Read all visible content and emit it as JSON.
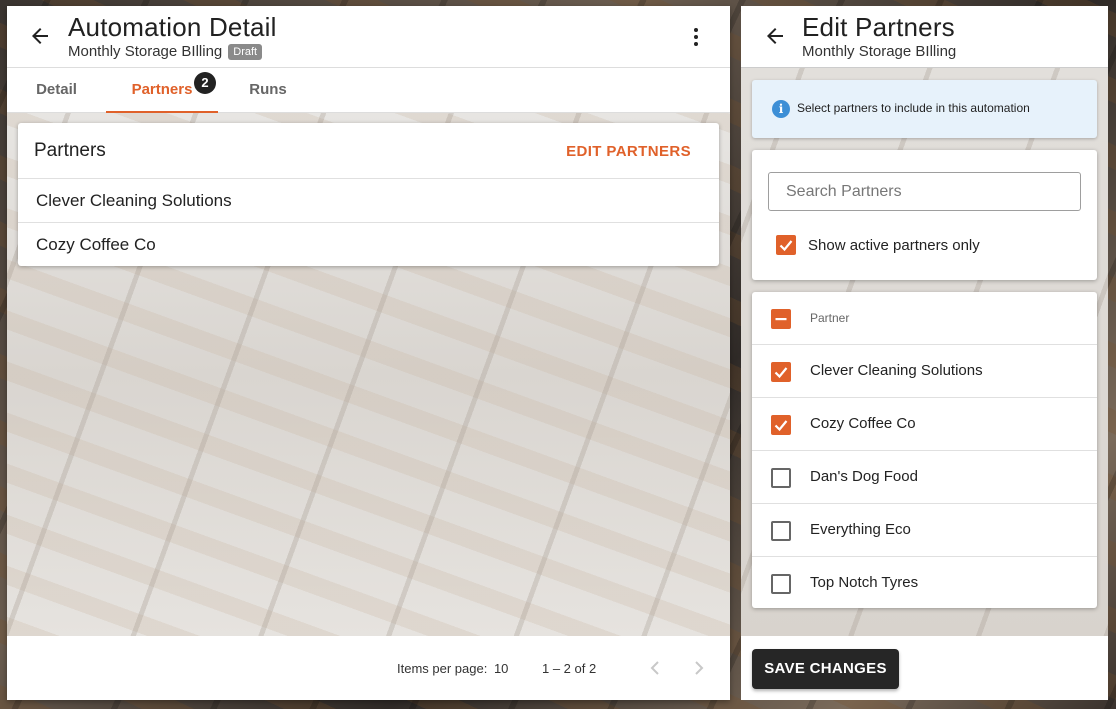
{
  "automation_detail": {
    "title": "Automation Detail",
    "subtitle": "Monthly Storage BIlling",
    "status_badge": "Draft",
    "tabs": [
      {
        "label": "Detail"
      },
      {
        "label": "Partners",
        "count": "2",
        "active": true
      },
      {
        "label": "Runs"
      }
    ],
    "partners_card": {
      "title": "Partners",
      "edit_label": "EDIT PARTNERS",
      "rows": [
        "Clever Cleaning Solutions",
        "Cozy Coffee Co"
      ]
    },
    "pagination": {
      "items_per_page_label": "Items per page:",
      "items_per_page": "10",
      "range": "1 – 2 of 2"
    }
  },
  "edit_partners": {
    "title": "Edit Partners",
    "subtitle": "Monthly Storage BIlling",
    "info_text": "Select partners to include in this automation",
    "search_placeholder": "Search Partners",
    "active_only_label": "Show active partners only",
    "active_only_checked": true,
    "list_header": "Partner",
    "partners": [
      {
        "name": "Clever Cleaning Solutions",
        "checked": true
      },
      {
        "name": "Cozy Coffee Co",
        "checked": true
      },
      {
        "name": "Dan's Dog Food",
        "checked": false
      },
      {
        "name": "Everything Eco",
        "checked": false
      },
      {
        "name": "Top Notch Tyres",
        "checked": false
      }
    ],
    "save_label": "SAVE CHANGES"
  },
  "colors": {
    "accent": "#e0612a",
    "info_bg": "#e7f2fb",
    "info_icon": "#3d8fd6",
    "button_dark": "#262626"
  }
}
